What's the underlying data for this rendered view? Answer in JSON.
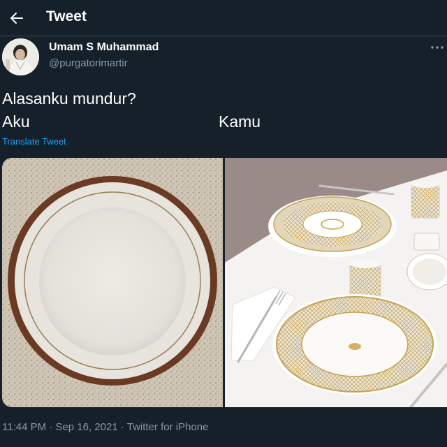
{
  "header": {
    "title": "Tweet",
    "back_icon": "arrow-left-icon"
  },
  "author": {
    "display_name": "Umam S Muhammad",
    "handle": "@purgatorimartir",
    "more_icon": "more-horizontal-icon"
  },
  "tweet": {
    "line1": "Alasanku mundur?",
    "line2_left": "Aku",
    "line2_right": "Kamu",
    "translate_label": "Translate Tweet"
  },
  "meta": {
    "time": "11:44 PM",
    "separator": " · ",
    "date": "Sep 16, 2021",
    "source": "Twitter for iPhone"
  },
  "colors": {
    "background": "#15202b",
    "secondary_text": "#8899a6",
    "link": "#1da1f2",
    "divider": "#38444d"
  }
}
